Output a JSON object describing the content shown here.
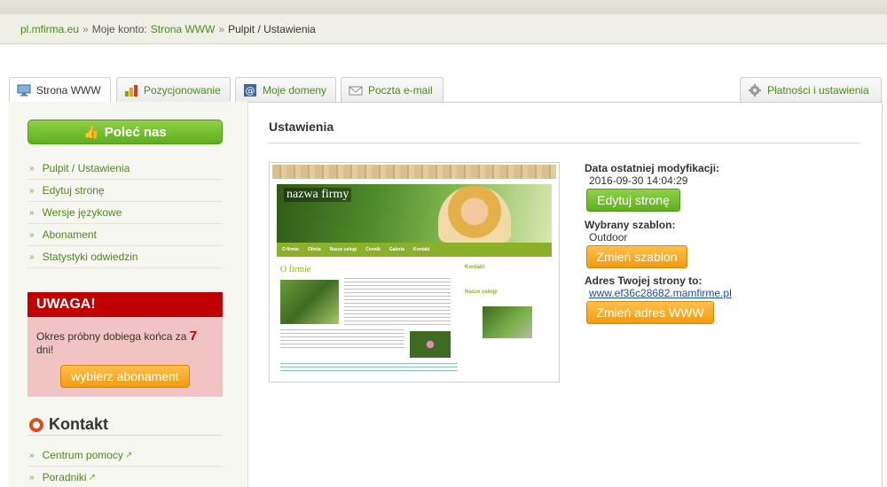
{
  "breadcrumb": {
    "site": "pl.mfirma.eu",
    "sep1": "»",
    "account_label": "Moje konto:",
    "account_link": "Strona WWW",
    "sep2": "»",
    "current": "Pulpit / Ustawienia"
  },
  "tabs": [
    {
      "label": "Strona WWW",
      "icon": "monitor-icon"
    },
    {
      "label": "Pozycjonowanie",
      "icon": "bar-chart-icon"
    },
    {
      "label": "Moje domeny",
      "icon": "at-sign-icon"
    },
    {
      "label": "Poczta e-mail",
      "icon": "envelope-icon"
    },
    {
      "label": "Płatności i ustawienia",
      "icon": "gear-icon"
    }
  ],
  "sidebar": {
    "recommend_label": "Poleć nas",
    "menu": [
      {
        "label": "Pulpit / Ustawienia"
      },
      {
        "label": "Edytuj stronę"
      },
      {
        "label": "Wersje językowe"
      },
      {
        "label": "Abonament"
      },
      {
        "label": "Statystyki odwiedzin"
      }
    ],
    "warning": {
      "title": "UWAGA!",
      "text_before": "Okres próbny dobiega końca za",
      "days": "7",
      "text_after": "dni!",
      "button": "wybierz abonament"
    },
    "contact": {
      "title": "Kontakt",
      "items": [
        {
          "label": "Centrum pomocy"
        },
        {
          "label": "Poradniki"
        }
      ]
    }
  },
  "main": {
    "title": "Ustawienia",
    "preview": {
      "site_name": "nazwa firmy",
      "nav": [
        "O firmie",
        "Oferta",
        "Nasze usługi",
        "Cennik",
        "Galeria",
        "Kontakt"
      ],
      "heading": "O firmie",
      "side_heading1": "Kontakt",
      "side_heading2": "Nasze usługi"
    },
    "last_modified_label": "Data ostatniej modyfikacji:",
    "last_modified_value": "2016-09-30 14:04:29",
    "edit_button": "Edytuj stronę",
    "template_label": "Wybrany szablon:",
    "template_value": "Outdoor",
    "change_template_button": "Zmień szablon",
    "address_label": "Adres Twojej strony to:",
    "address_value": "www.ef36c28682.mamfirme.pl",
    "change_address_button": "Zmień adres WWW"
  },
  "colors": {
    "accent_green": "#5fae1e",
    "link_green": "#4a8a1e",
    "warning_red": "#c00000",
    "button_orange": "#f29a10"
  }
}
